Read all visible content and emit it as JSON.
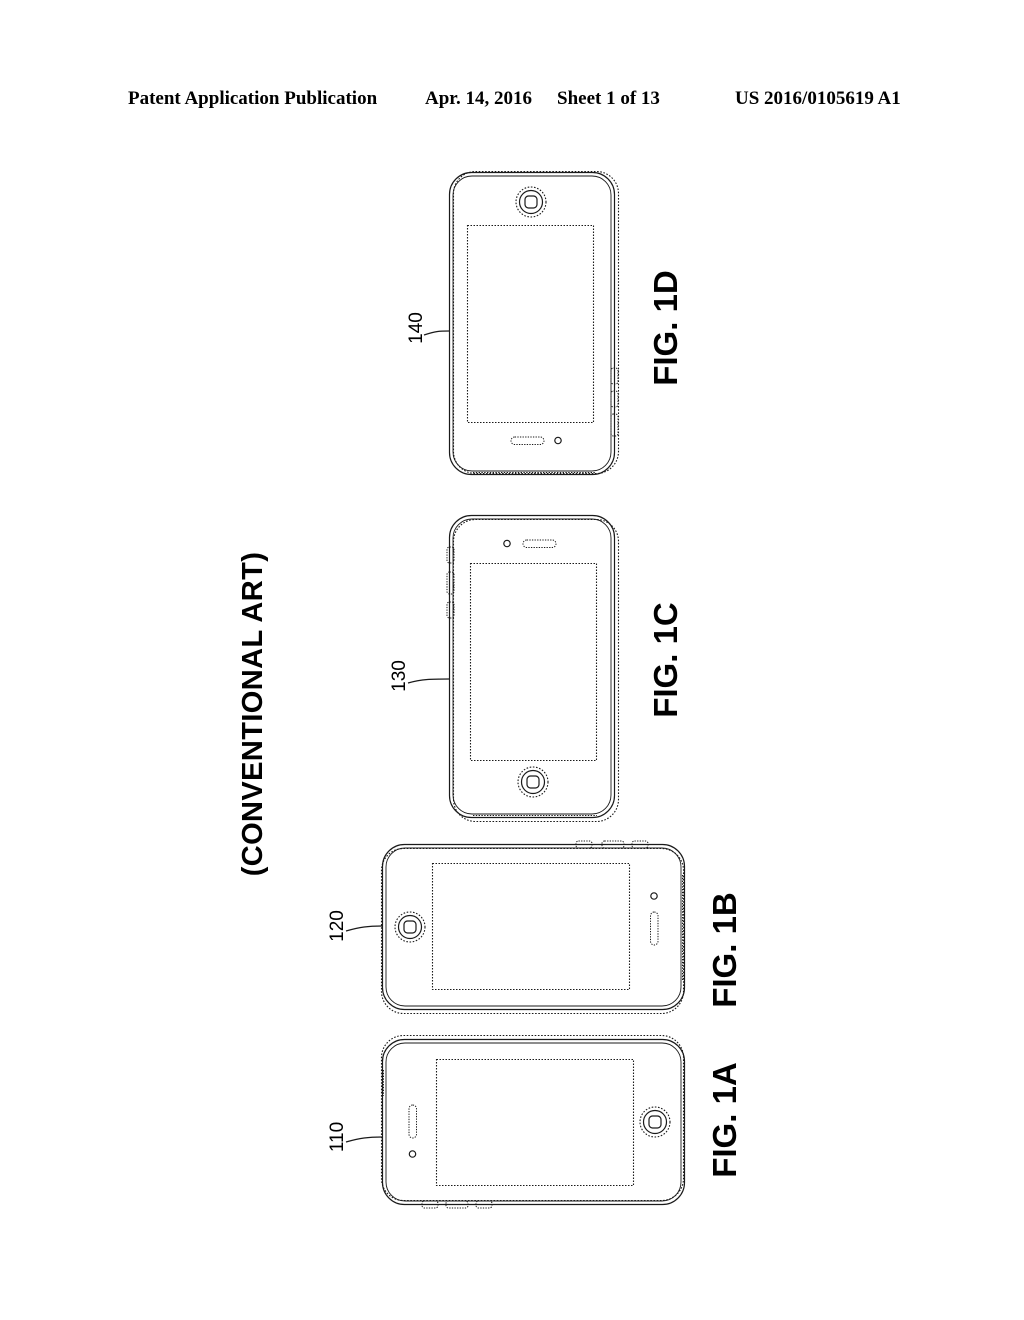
{
  "document": {
    "type": "patent-drawing-sheet",
    "background_color": "#ffffff",
    "line_color": "#1a1a1a"
  },
  "header": {
    "publication": "Patent Application Publication",
    "date": "Apr. 14, 2016",
    "sheet": "Sheet 1 of 13",
    "patent_number": "US 2016/0105619 A1"
  },
  "banner": {
    "conventional_art": "(CONVENTIONAL ART)"
  },
  "figures": [
    {
      "id": "fig-1d",
      "caption": "FIG. 1D",
      "reference_numeral": "140",
      "orientation": "portrait-rotated",
      "home_button_position": "top",
      "earpiece_position": "bottom",
      "side_button_edge": "right",
      "side_button_count": 3
    },
    {
      "id": "fig-1c",
      "caption": "FIG. 1C",
      "reference_numeral": "130",
      "orientation": "portrait-rotated",
      "home_button_position": "bottom",
      "earpiece_position": "top",
      "side_button_edge": "left",
      "side_button_count": 3
    },
    {
      "id": "fig-1b",
      "caption": "FIG. 1B",
      "reference_numeral": "120",
      "orientation": "landscape-rotated",
      "home_button_position": "left",
      "earpiece_position": "right",
      "side_button_edge": "top",
      "side_button_count": 3
    },
    {
      "id": "fig-1a",
      "caption": "FIG. 1A",
      "reference_numeral": "110",
      "orientation": "landscape-rotated",
      "home_button_position": "right",
      "earpiece_position": "left",
      "side_button_edge": "bottom",
      "side_button_count": 3
    }
  ]
}
